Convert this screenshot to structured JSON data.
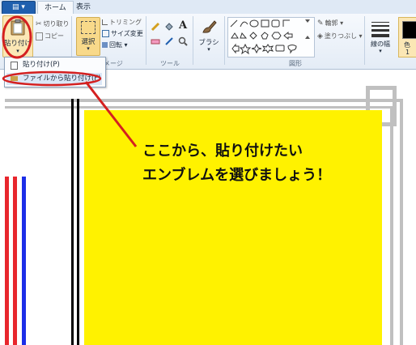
{
  "tabs": {
    "home": "ホーム",
    "view": "表示"
  },
  "clipboard": {
    "paste": "貼り付け",
    "cut": "切り取り",
    "copy": "コピー"
  },
  "image": {
    "select": "選択",
    "trim": "トリミング",
    "resize": "サイズ変更",
    "rotate": "回転",
    "label": "メージ"
  },
  "tools": {
    "label": "ツール",
    "text_tool": "A"
  },
  "brushes": {
    "label": "ブラシ"
  },
  "shapes": {
    "label": "図形",
    "outline": "輪郭",
    "fill": "塗りつぶし"
  },
  "line_width": {
    "label": "線の幅"
  },
  "colors": {
    "label": "色",
    "number": "1"
  },
  "paste_menu": {
    "item1": "貼り付け(P)",
    "item2": "ファイルから貼り付け(F)"
  },
  "caption": {
    "line1": "ここから、貼り付けたい",
    "line2": "エンブレムを選びましょう！"
  },
  "palette": {
    "yellow": "#fff200",
    "red": "#e8262d",
    "blue": "#1c2ee8",
    "grey": "#c0c0c0",
    "accent": "#d42020"
  }
}
